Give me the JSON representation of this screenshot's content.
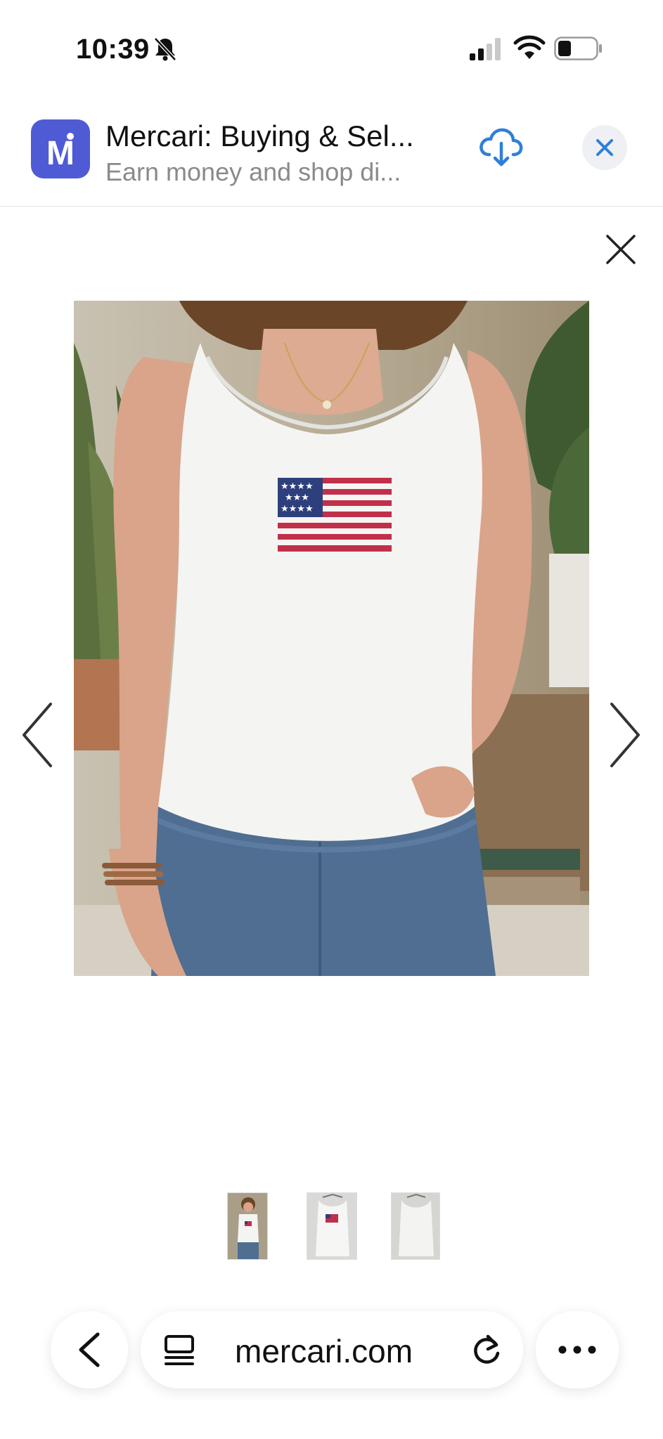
{
  "status_bar": {
    "time": "10:39",
    "icons": [
      "bell-slash-icon",
      "cellular-signal-icon",
      "wifi-icon",
      "battery-icon"
    ]
  },
  "app_banner": {
    "logo_letter": "M",
    "app_name": "Mercari: Buying & Sel...",
    "subtitle": "Earn money and shop di...",
    "brand_color": "#4f5bd5",
    "action_color": "#2f7fd8",
    "icons": [
      "download-cloud-icon",
      "close-icon"
    ]
  },
  "viewer": {
    "icons": [
      "close-icon",
      "chevron-left-icon",
      "chevron-right-icon"
    ],
    "thumbnail_count": 3
  },
  "toolbar": {
    "url": "mercari.com",
    "icons": [
      "back-icon",
      "tabs-icon",
      "reload-icon",
      "more-icon"
    ]
  }
}
